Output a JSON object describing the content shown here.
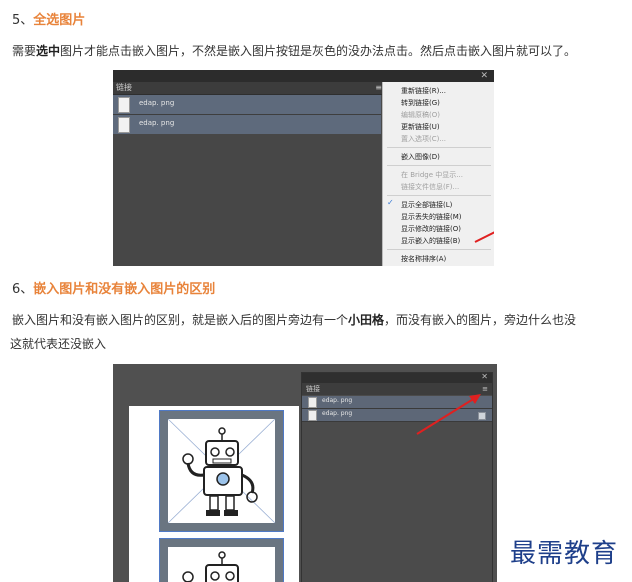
{
  "section5": {
    "number": "5、",
    "title": "全选图片",
    "para_parts": [
      "需要",
      "选中",
      "图片才能点击嵌入图片，不然是嵌入图片按钮是灰色的没办法点击。然后点击嵌入图片就可以了。"
    ]
  },
  "shot1": {
    "panel_tab": "链接",
    "menu_button": "≡",
    "close_symbol": "✕",
    "rows": [
      {
        "file": "edap. png"
      },
      {
        "file": "edap. png"
      }
    ],
    "menu": [
      {
        "label": "重新链接(R)...",
        "disabled": false
      },
      {
        "label": "转到链接(G)",
        "disabled": false
      },
      {
        "label": "编辑原稿(O)",
        "disabled": true
      },
      {
        "label": "更新链接(U)",
        "disabled": false
      },
      {
        "label": "置入选项(C)...",
        "disabled": true
      },
      {
        "label": "嵌入图像(D)",
        "disabled": false
      },
      {
        "label": "在 Bridge 中显示...",
        "disabled": true
      },
      {
        "label": "链接文件信息(F)...",
        "disabled": true
      },
      {
        "label": "显示全部链接(L)",
        "disabled": false,
        "checked": true
      },
      {
        "label": "显示丢失的链接(M)",
        "disabled": false
      },
      {
        "label": "显示修改的链接(O)",
        "disabled": false
      },
      {
        "label": "显示嵌入的链接(B)",
        "disabled": false
      },
      {
        "label": "按名称排序(A)",
        "disabled": false
      }
    ],
    "check_mark": "✓"
  },
  "section6": {
    "number": "6、",
    "title": "嵌入图片和没有嵌入图片的区别",
    "para_line1_parts": [
      "嵌入图片和没有嵌入图片的区别，就是嵌入后的图片旁边有一个",
      "小田格",
      "，而没有嵌入的图片，旁边什么也没"
    ],
    "para_line2": "这就代表还没嵌入"
  },
  "shot2": {
    "panel_tab": "链接",
    "menu_button": "≡",
    "close_symbol": "✕",
    "rows": [
      {
        "file": "edap. png",
        "embedded": false
      },
      {
        "file": "edap. png",
        "embedded": true
      }
    ]
  },
  "watermark": "最需教育",
  "colors": {
    "accent": "#e8833a",
    "arrow": "#e02020",
    "logo": "#1e3f8a"
  }
}
